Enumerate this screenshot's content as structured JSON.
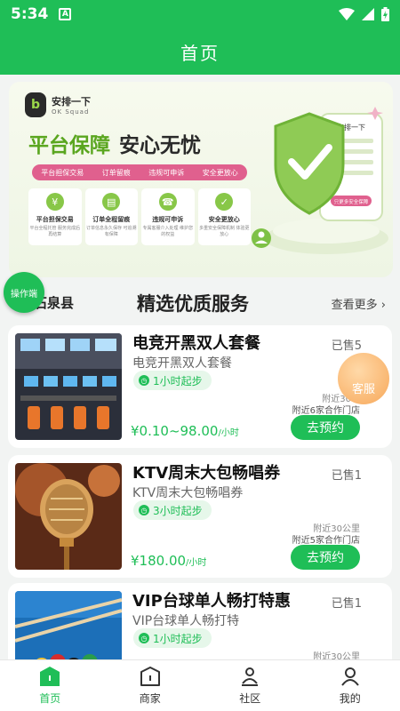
{
  "status_bar": {
    "time": "5:34",
    "a_badge": "A"
  },
  "header": {
    "title": "首页"
  },
  "banner": {
    "logo_mark": "b",
    "brand": "安排一下",
    "brand_sub": "OK Squad",
    "headline_1": "平台保障",
    "headline_2": "安心无忧",
    "tags": [
      "平台担保交易",
      "订单留痕",
      "违规可申诉",
      "安全更放心"
    ],
    "features": [
      {
        "icon": "¥",
        "title": "平台担保交易",
        "desc": "平台全程托管 服务完成后再结算"
      },
      {
        "icon": "▤",
        "title": "订单全程留痕",
        "desc": "订单信息永久保存 可追溯有保障"
      },
      {
        "icon": "☎",
        "title": "违规可申诉",
        "desc": "专属客服介入处理 维护您的权益"
      },
      {
        "icon": "✓",
        "title": "安全更放心",
        "desc": "多重安全保障机制 体验更放心"
      }
    ],
    "phone_brand": "安排一下",
    "phone_button": "只更多安全保障"
  },
  "float_button": {
    "label": "操作端"
  },
  "section": {
    "location": "石泉县",
    "title": "精选优质服务",
    "more": "查看更多"
  },
  "customer_service": {
    "label": "客服"
  },
  "cards": [
    {
      "title": "电竞开黑双人套餐",
      "subtitle": "电竞开黑双人套餐",
      "sold": "已售5",
      "badge": "1小时起步",
      "distance": "附近30公",
      "stores": "附近6家合作门店",
      "price": "¥0.10~98.00",
      "unit": "/小时",
      "cta": "去预约"
    },
    {
      "title": "KTV周末大包畅唱券",
      "subtitle": "KTV周末大包畅唱券",
      "sold": "已售1",
      "badge": "3小时起步",
      "distance": "附近30公里",
      "stores": "附近5家合作门店",
      "price": "¥180.00",
      "unit": "/小时",
      "cta": "去预约"
    },
    {
      "title": "VIP台球单人畅打特惠",
      "subtitle": "VIP台球单人畅打特",
      "sold": "已售1",
      "badge": "1小时起步",
      "distance": "附近30公里",
      "stores": "",
      "price": "",
      "unit": "",
      "cta": ""
    }
  ],
  "tabbar": {
    "active_index": 0,
    "items": [
      {
        "label": "首页",
        "icon": "home-icon"
      },
      {
        "label": "商家",
        "icon": "shop-icon"
      },
      {
        "label": "社区",
        "icon": "community-icon"
      },
      {
        "label": "我的",
        "icon": "profile-icon"
      }
    ]
  },
  "colors": {
    "primary": "#1fbe57",
    "accent_pink": "#e0608e",
    "banner_green": "#5aa61f"
  }
}
